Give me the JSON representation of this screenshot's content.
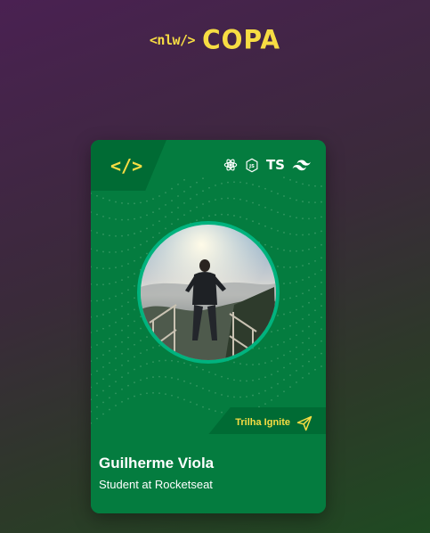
{
  "logo": {
    "nlw": "<nlw/>",
    "copa": "COPA"
  },
  "card": {
    "code_symbol": "</>",
    "techs": [
      "react-icon",
      "nodejs-icon",
      "TS",
      "tailwind-icon"
    ],
    "ts_label": "TS",
    "track_label": "Trilha Ignite",
    "name": "Guilherme Viola",
    "role": "Student at Rocketseat"
  },
  "colors": {
    "brand_yellow": "#f7dd43",
    "card_green": "#047c3f",
    "ring": "#00b37e"
  }
}
